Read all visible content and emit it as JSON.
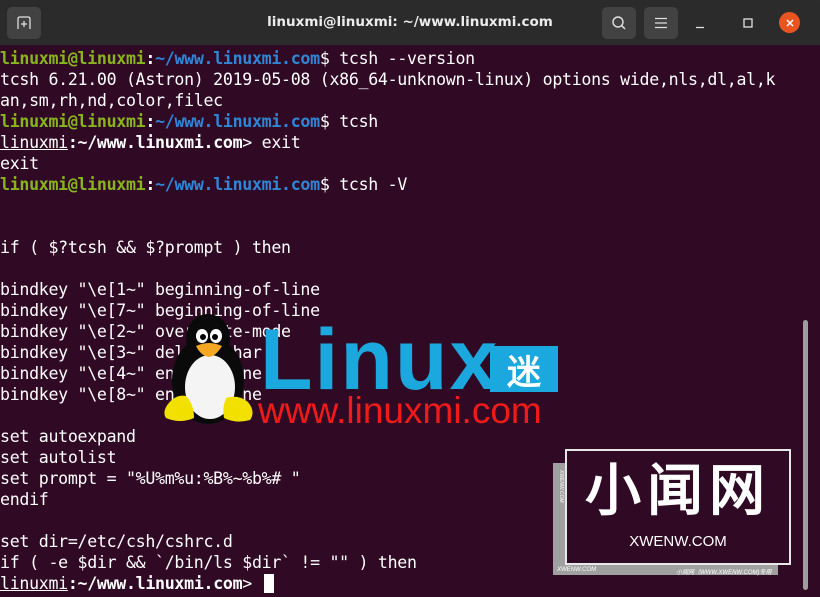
{
  "window": {
    "title": "linuxmi@linuxmi: ~/www.linuxmi.com",
    "new_tab_icon": "new-tab-icon",
    "search_icon": "search-icon",
    "menu_icon": "hamburger-menu-icon",
    "minimize_icon": "minimize-icon",
    "maximize_icon": "maximize-icon",
    "close_icon": "close-icon",
    "close_color": "#e95420"
  },
  "terminal": {
    "background": "#300a24",
    "prompt_user_host": "linuxmi@linuxmi",
    "prompt_path": "~/www.linuxmi.com",
    "tcsh_prompt_user": "linuxmi",
    "tcsh_prompt_path": "~/www.linuxmi.com",
    "lines": [
      {
        "type": "bash",
        "cmd": " tcsh --version"
      },
      {
        "type": "out",
        "text": "tcsh 6.21.00 (Astron) 2019-05-08 (x86_64-unknown-linux) options wide,nls,dl,al,k"
      },
      {
        "type": "out",
        "text": "an,sm,rh,nd,color,filec"
      },
      {
        "type": "bash",
        "cmd": " tcsh"
      },
      {
        "type": "tcsh",
        "cmd": " exit"
      },
      {
        "type": "out",
        "text": "exit"
      },
      {
        "type": "bash",
        "cmd": " tcsh -V"
      },
      {
        "type": "out",
        "text": ""
      },
      {
        "type": "out",
        "text": ""
      },
      {
        "type": "out",
        "text": "if ( $?tcsh && $?prompt ) then"
      },
      {
        "type": "out",
        "text": ""
      },
      {
        "type": "out",
        "text": "bindkey \"\\e[1~\" beginning-of-line"
      },
      {
        "type": "out",
        "text": "bindkey \"\\e[7~\" beginning-of-line"
      },
      {
        "type": "out",
        "text": "bindkey \"\\e[2~\" overwrite-mode"
      },
      {
        "type": "out",
        "text": "bindkey \"\\e[3~\" delete-char"
      },
      {
        "type": "out",
        "text": "bindkey \"\\e[4~\" end-of-line"
      },
      {
        "type": "out",
        "text": "bindkey \"\\e[8~\" end-of-line"
      },
      {
        "type": "out",
        "text": ""
      },
      {
        "type": "out",
        "text": "set autoexpand"
      },
      {
        "type": "out",
        "text": "set autolist"
      },
      {
        "type": "out",
        "text": "set prompt = \"%U%m%u:%B%~%b%# \""
      },
      {
        "type": "out",
        "text": "endif"
      },
      {
        "type": "out",
        "text": ""
      },
      {
        "type": "out",
        "text": "set dir=/etc/csh/cshrc.d"
      },
      {
        "type": "out",
        "text": "if ( -e $dir && `/bin/ls $dir` != \"\" ) then"
      },
      {
        "type": "tcsh_cursor",
        "cmd": " "
      }
    ]
  },
  "watermarks": {
    "linuxmi_logo_text": "Linux",
    "linuxmi_logo_cn": "迷",
    "linuxmi_url": "www.linuxmi.com",
    "linuxmi_color": "#1ba8de",
    "linuxmi_url_color": "#f01a1a",
    "mascot_icon": "tux-penguin-icon",
    "xwenw_title": "小闻网",
    "xwenw_url": "XWENW.COM",
    "xwenw_side": "XWENW.COM",
    "xwenw_footer_left": "XWENW.COM",
    "xwenw_footer_right": "小闻网（WWW.XWENW.COM)专用"
  }
}
